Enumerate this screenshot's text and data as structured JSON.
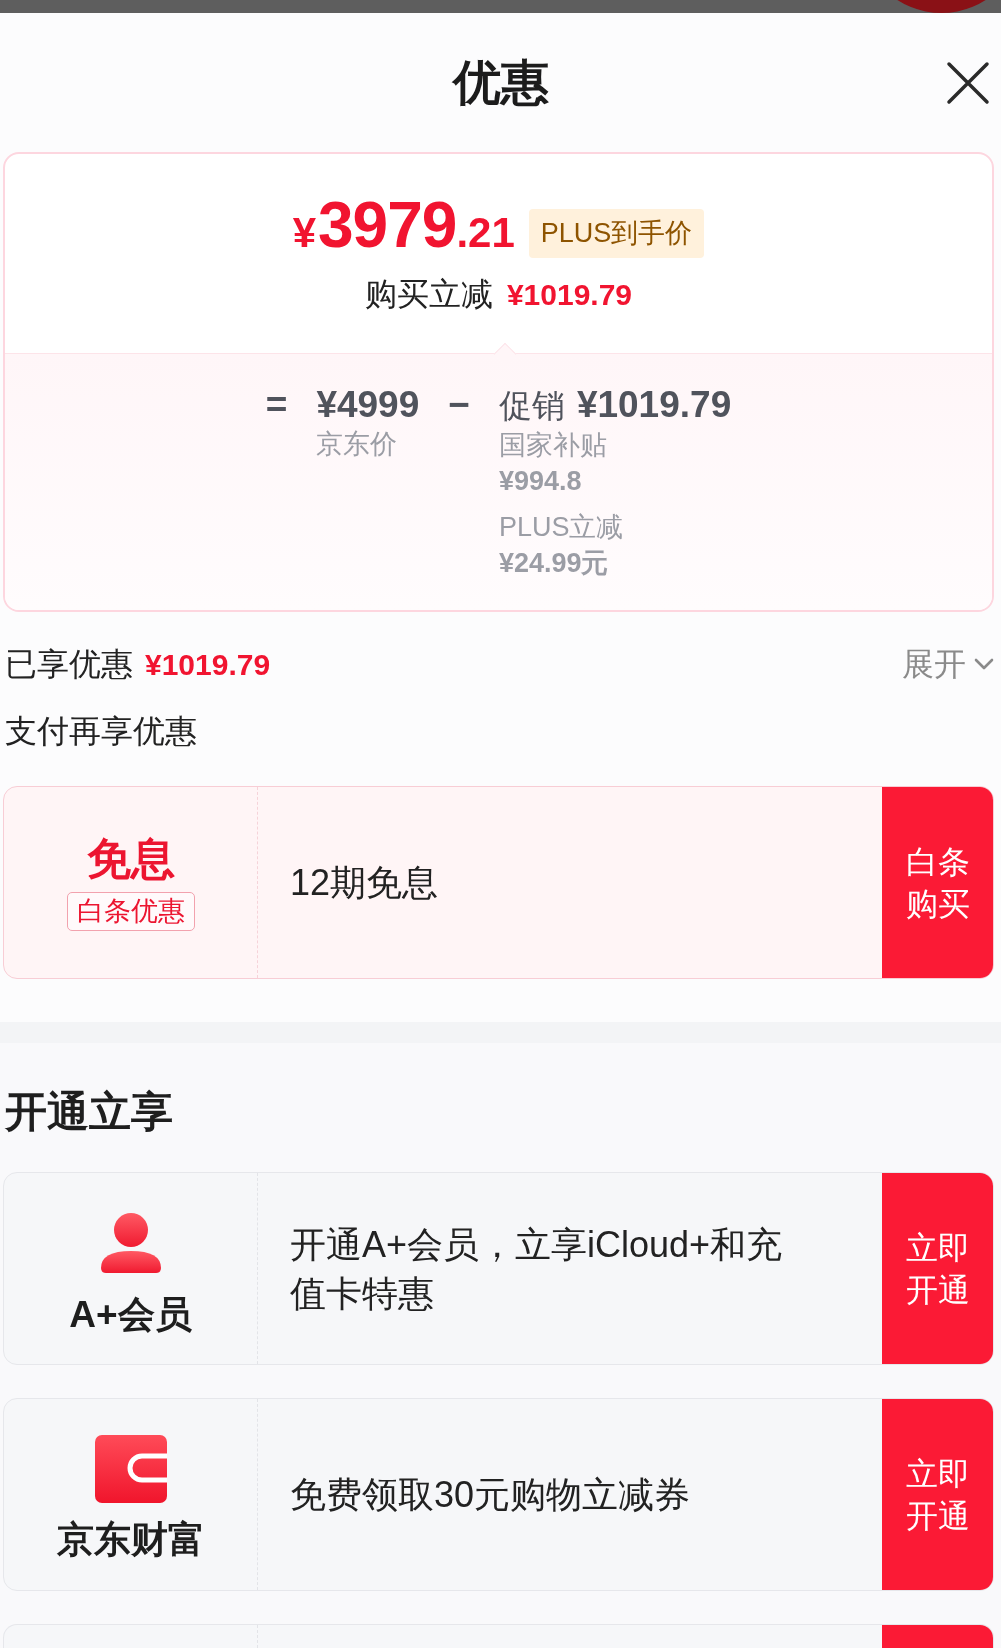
{
  "header": {
    "title": "优惠"
  },
  "price_card": {
    "final_price": "¥3979.21",
    "badge": "PLUS到手价",
    "reduction": {
      "label": "购买立减",
      "value": "¥1019.79"
    },
    "breakdown": {
      "equals": "=",
      "base": {
        "value": "¥4999",
        "label": "京东价"
      },
      "minus": "−",
      "promo": {
        "label": "促销",
        "value": "¥1019.79",
        "details": [
          {
            "label": "国家补贴",
            "value": "¥994.8"
          },
          {
            "label": "PLUS立减",
            "value": "¥24.99元"
          }
        ]
      }
    }
  },
  "savings": {
    "label": "已享优惠",
    "value": "¥1019.79",
    "toggle": "展开",
    "expanded": false
  },
  "pay_section": {
    "title": "支付再享优惠",
    "offers": [
      {
        "kind": "promo_tag",
        "title": "免息",
        "tag": "白条优惠",
        "text": "12期免息",
        "action": "白条购买"
      }
    ]
  },
  "open_section": {
    "title": "开通立享",
    "offers": [
      {
        "kind": "member",
        "title": "A+会员",
        "text": "开通A+会员，立享iCloud+和充值卡特惠",
        "action": "立即开通"
      },
      {
        "kind": "finance",
        "title": "京东财富",
        "text": "免费领取30元购物立减券",
        "action": "立即开通"
      }
    ],
    "more_below": true
  }
}
